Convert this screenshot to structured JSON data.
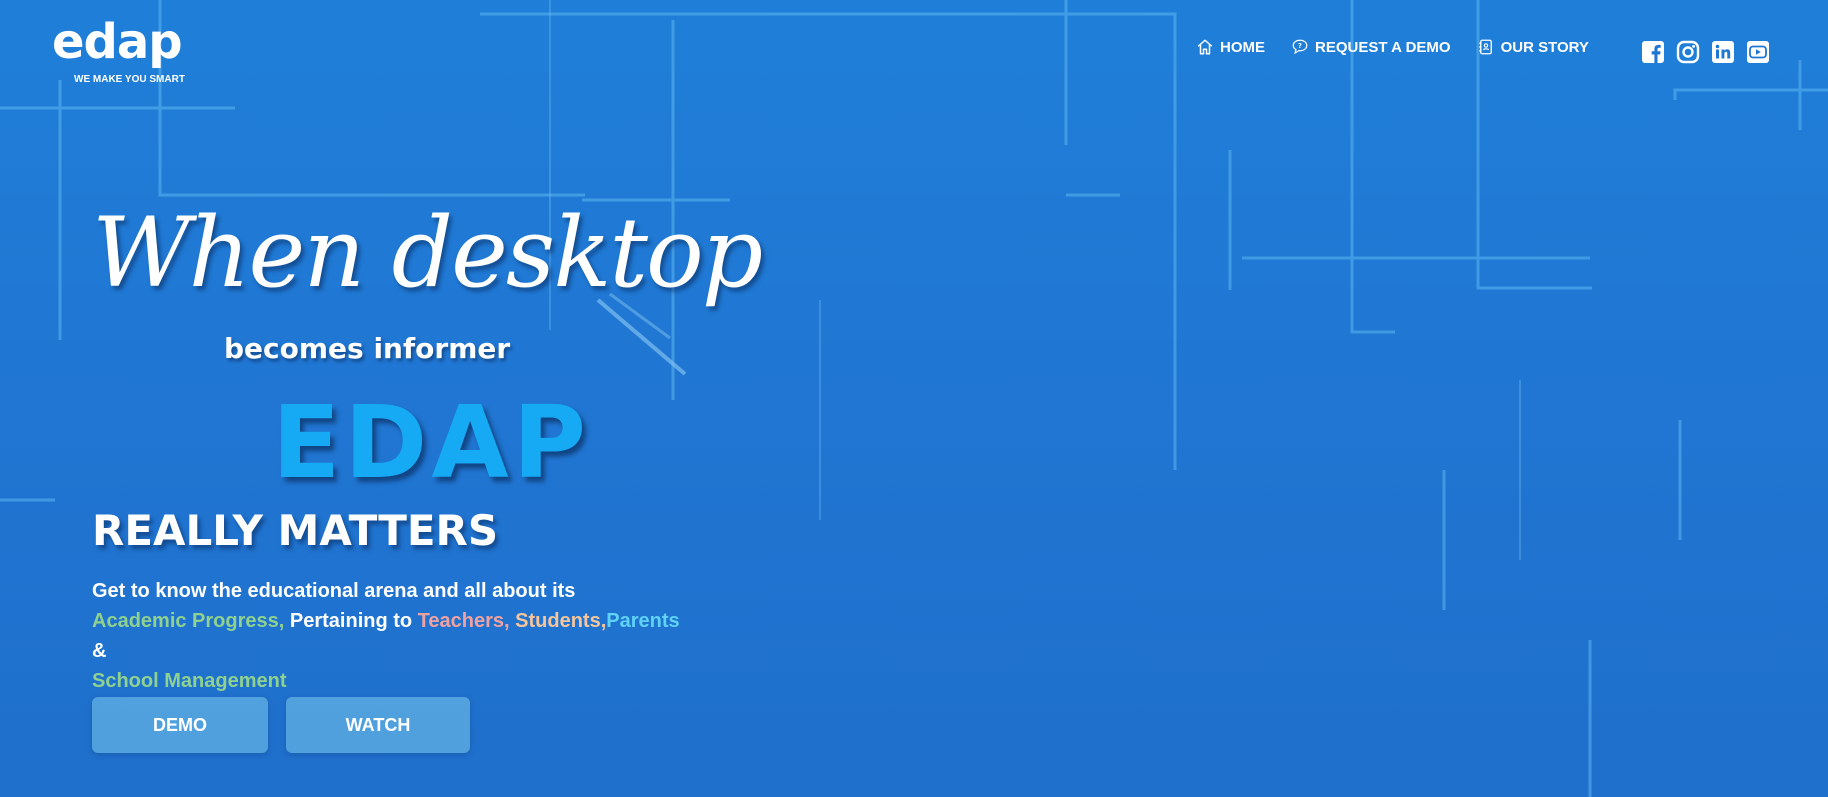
{
  "colors": {
    "background": "#2077d3",
    "edap_accent": "#16a9f4",
    "academic": "#8fd18e",
    "teachers": "#f0a2a2",
    "students": "#f5c69c",
    "parents": "#5fd2f5"
  },
  "header": {
    "logo": {
      "word": "edap",
      "tagline": "WE MAKE YOU SMART"
    },
    "nav": [
      {
        "icon": "home-icon",
        "label": "HOME"
      },
      {
        "icon": "chat-bubble-icon",
        "label": "REQUEST A DEMO"
      },
      {
        "icon": "contact-book-icon",
        "label": "OUR STORY"
      }
    ],
    "social": [
      "facebook-icon",
      "instagram-icon",
      "linkedin-icon",
      "youtube-icon"
    ]
  },
  "hero": {
    "script_line": "When desktop",
    "subline": "becomes informer",
    "brand": "EDAP",
    "headline": "REALLY MATTERS",
    "description": {
      "intro": "Get to know the educational arena and all about its",
      "academic": "Academic Progress,",
      "pertaining": " Pertaining to ",
      "teachers": "Teachers,",
      "students": " Students,",
      "parents": "Parents",
      "amp": " &",
      "school": "School Management"
    },
    "buttons": {
      "demo": "DEMO",
      "watch": "WATCH"
    }
  }
}
